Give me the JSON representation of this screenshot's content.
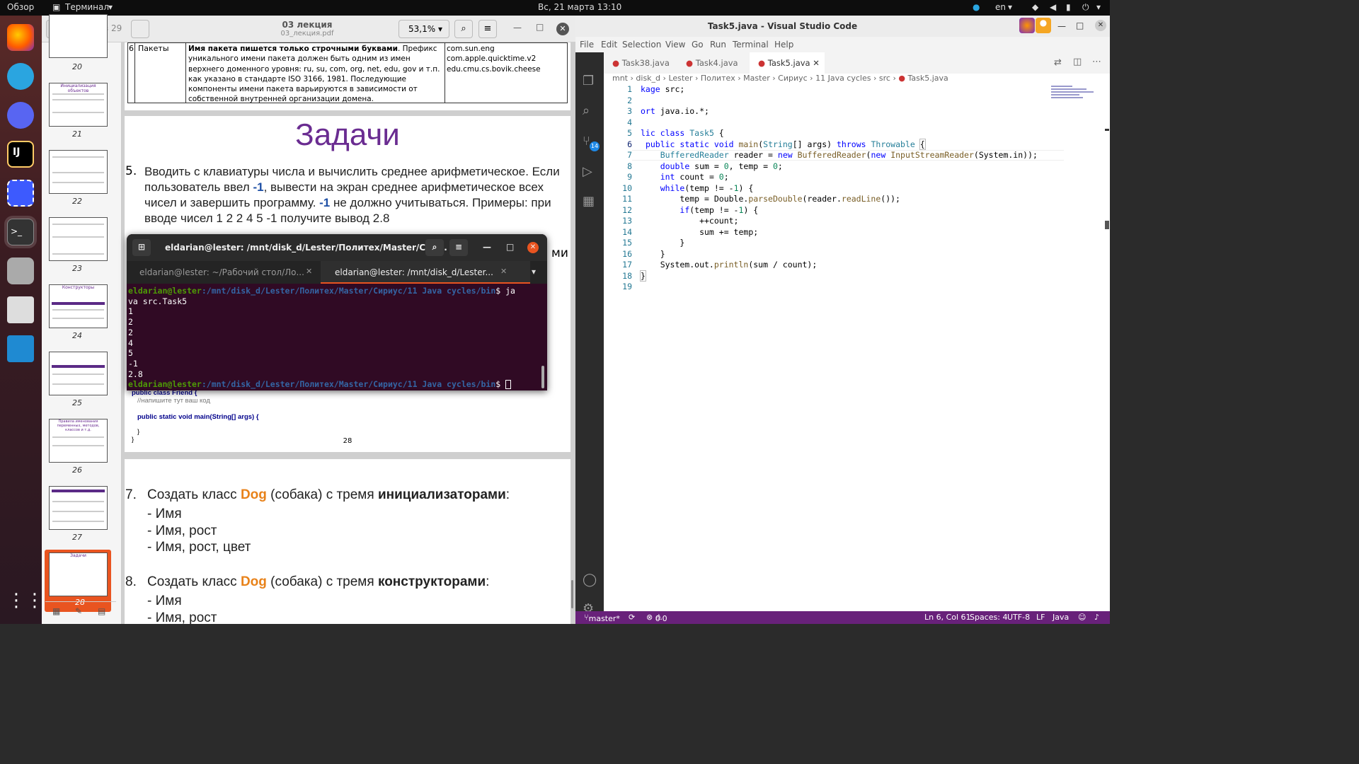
{
  "topbar": {
    "overview": "Обзор",
    "app": "Терминал",
    "clock": "Вс, 21 марта  13:10",
    "lang": "en"
  },
  "dock": {
    "icons": [
      "firefox-icon",
      "telegram-icon",
      "discord-icon",
      "intellij-icon",
      "screenshot-icon",
      "terminal-icon",
      "files-icon",
      "document-viewer-icon",
      "vscode-icon",
      "app-grid-icon"
    ]
  },
  "pdf": {
    "page_current": "28",
    "page_of": "из 29",
    "title": "03 лекция",
    "filename": "03_лекция.pdf",
    "zoom": "53,1%",
    "thumbs": [
      {
        "n": "20"
      },
      {
        "n": "21",
        "t": "Инициализация объектов"
      },
      {
        "n": "22"
      },
      {
        "n": "23"
      },
      {
        "n": "24",
        "t": "Конструкторы"
      },
      {
        "n": "25"
      },
      {
        "n": "26",
        "t": "Правила именования переменных, методов, классов и т.д."
      },
      {
        "n": "27"
      },
      {
        "n": "28",
        "t": "Задачи"
      }
    ],
    "table_row": {
      "num": "6",
      "name": "Пакеты",
      "desc_bold": "Имя пакета пишется только строчными буквами",
      "desc": ". Префикс уникального имени пакета должен быть одним из имен верхнего доменного уровня: ru, su, com, org, net, edu, gov и т.п. как указано в стандарте ISO 3166, 1981. Последующие компоненты имени пакета варьируются в зависимости от собственной внутренней организации домена.",
      "examples": [
        "com.sun.eng",
        "com.apple.quicktime.v2",
        "edu.cmu.cs.bovik.cheese"
      ]
    },
    "heading": "Задачи",
    "task5_num": "5.",
    "task5_a": "Вводить с клавиатуры числа и вычислить среднее арифметическое. Если пользователь ввел ",
    "task5_b": "-1",
    "task5_c": ", вывести на экран среднее арифметическое всех чисел и завершить программу. ",
    "task5_d": "-1",
    "task5_e": " не должно учитываться. Примеры: при вводе чисел 1 2 2 4 5 -1 получите вывод 2.8",
    "task6_tail": "ми",
    "code_lines": [
      "public class Friend {",
      "//напишите тут ваш код",
      "public static void main(String[] args) {",
      "}",
      "}"
    ],
    "page_number": "28",
    "task7_num": "7.",
    "task7_a": "Создать класс ",
    "task7_dog": "Dog",
    "task7_b": " (собака) с тремя ",
    "task7_c": "инициализаторами",
    "task7_colon": ":",
    "task7_items": [
      "- Имя",
      "- Имя, рост",
      "- Имя, рост, цвет"
    ],
    "task8_num": "8.",
    "task8_a": "Создать класс ",
    "task8_dog": "Dog",
    "task8_b": " (собака) с тремя ",
    "task8_c": "конструкторами",
    "task8_colon": ":",
    "task8_items": [
      "- Имя",
      "- Имя, рост",
      "- И"
    ]
  },
  "terminal": {
    "title": "eldarian@lester: /mnt/disk_d/Lester/Политех/Master/Сир...",
    "tab1": "eldarian@lester: ~/Рабочий стол/Ло...",
    "tab2": "eldarian@lester: /mnt/disk_d/Lester...",
    "prompt_user": "eldarian@lester",
    "prompt_path": ":/mnt/disk_d/Lester/Политех/Master/Сириус/11 Java cycles/bin",
    "cmd1": "$ ja",
    "cmd2": "va src.Task5",
    "output": [
      "1",
      "2",
      "2",
      "4",
      "5",
      "-1",
      "2.8"
    ],
    "prompt_end": "$ "
  },
  "vscode": {
    "title": "Task5.java - Visual Studio Code",
    "menu": [
      "File",
      "Edit",
      "Selection",
      "View",
      "Go",
      "Run",
      "Terminal",
      "Help"
    ],
    "tabs": [
      "Task38.java",
      "Task4.java",
      "Task5.java"
    ],
    "breadcrumb": [
      "mnt",
      "disk_d",
      "Lester",
      "Политех",
      "Master",
      "Сириус",
      "11 Java cycles",
      "src",
      "Task5.java"
    ],
    "scm_badge": "14",
    "line_numbers": [
      "1",
      "2",
      "3",
      "4",
      "5",
      "6",
      "7",
      "8",
      "9",
      "10",
      "11",
      "12",
      "13",
      "14",
      "15",
      "16",
      "17",
      "18",
      "19"
    ],
    "status": {
      "branch": "master*",
      "errors": "0",
      "warnings": "0",
      "position": "Ln 6, Col 61",
      "spaces": "Spaces: 4",
      "encoding": "UTF-8",
      "eol": "LF",
      "lang": "Java"
    }
  }
}
